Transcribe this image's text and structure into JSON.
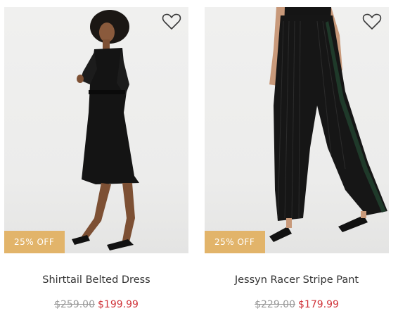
{
  "products": [
    {
      "name": "Shirttail Belted Dress",
      "badge": "25% OFF",
      "original_price": "$259.00",
      "sale_price": "$199.99",
      "wishlist_icon": "heart-outline-icon"
    },
    {
      "name": "Jessyn Racer Stripe Pant",
      "badge": "25% OFF",
      "original_price": "$229.00",
      "sale_price": "$179.99",
      "wishlist_icon": "heart-outline-icon"
    }
  ],
  "colors": {
    "badge_bg": "#e2b46a",
    "sale_price": "#d0343a",
    "original_price": "#9a9a9a"
  }
}
